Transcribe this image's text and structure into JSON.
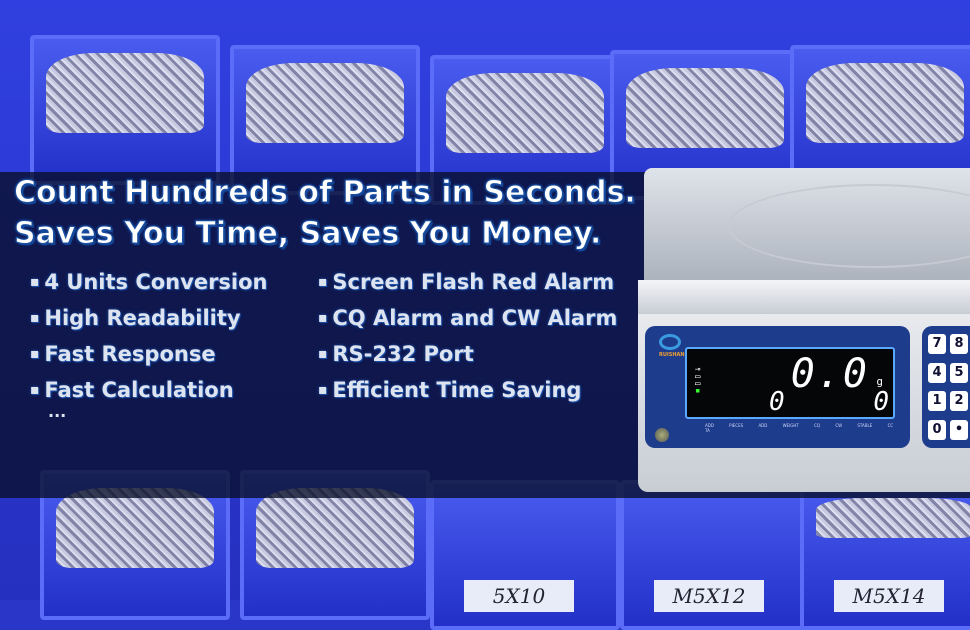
{
  "headline": [
    "Count Hundreds of Parts in Seconds.",
    "Saves You Time, Saves You Money."
  ],
  "features_left": [
    "4 Units Conversion",
    "High Readability",
    "Fast Response",
    "Fast Calculation"
  ],
  "features_right": [
    "Screen Flash Red Alarm",
    "CQ Alarm and CW Alarm",
    "RS-232 Port",
    "Efficient Time Saving"
  ],
  "more": "...",
  "bin_labels": [
    "5X10",
    "M5X12",
    "M5X14"
  ],
  "scale": {
    "brand": "RUISHAN",
    "weight": "0.0",
    "unit": "g",
    "unit_weight": "0",
    "count": "0",
    "indicators": [
      "ADD PIECES",
      "ADD WEIGHT",
      "CQ",
      "CW",
      "STABLE",
      "CC",
      "TA"
    ],
    "keys": [
      "7",
      "8",
      "4",
      "5",
      "1",
      "2",
      "0",
      "•"
    ]
  },
  "colors": {
    "bins": "#3040e0",
    "text_outline": "#1b4fa8",
    "display_panel": "#1e3c8c"
  }
}
